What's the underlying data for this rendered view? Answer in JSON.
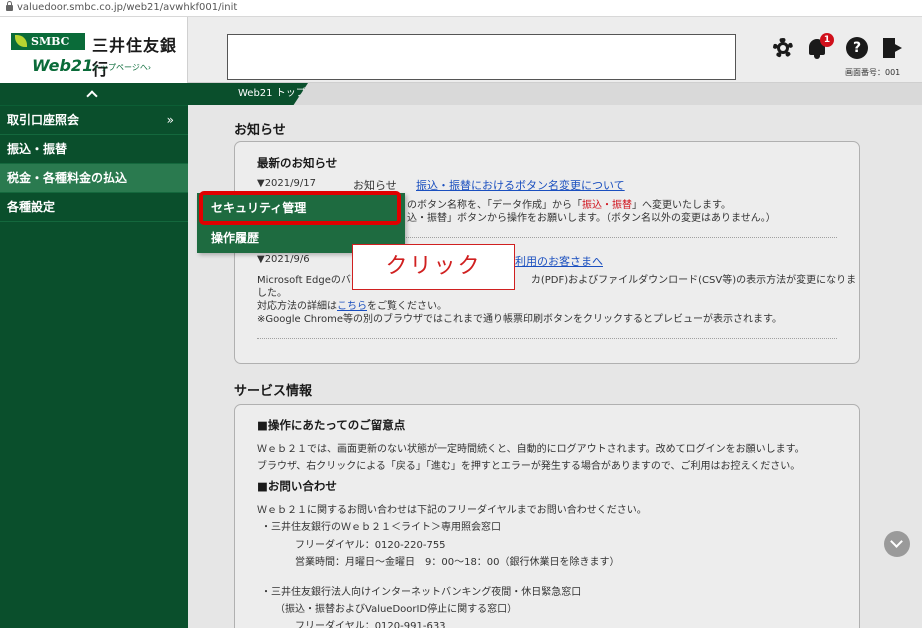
{
  "browser": {
    "url": "valuedoor.smbc.co.jp/web21/avwhkf001/init"
  },
  "header": {
    "brand_badge": "SMBC",
    "bank_name": "三井住友銀行",
    "web21": "Web21",
    "top_link": "トップページへ›",
    "notification_count": "1",
    "help_glyph": "?",
    "screen_number": "画面番号：001"
  },
  "sidebar": {
    "items": [
      {
        "label": "取引口座照会",
        "more": "»"
      },
      {
        "label": "振込・振替"
      },
      {
        "label": "税金・各種料金の払込"
      },
      {
        "label": "各種設定"
      }
    ]
  },
  "flyout": {
    "items": [
      {
        "label": "セキュリティ管理"
      },
      {
        "label": "操作履歴"
      }
    ]
  },
  "breadcrumb": {
    "label": "Web21 トップ"
  },
  "notice": {
    "title": "お知らせ",
    "latest_title": "最新のお知らせ",
    "item1": {
      "date": "▼2021/9/17",
      "category": "お知らせ",
      "link": "振込・振替におけるボタン名変更について",
      "line1_a": "のボタン名称を、「データ作成」から「",
      "line1_red": "振込・振替",
      "line1_b": "」へ変更いたします。",
      "line2": "込・振替」ボタンから操作をお願いします。（ボタン名以外の変更はありません。）"
    },
    "item2": {
      "date": "▼2021/9/6",
      "link_partial": "利用のお客さまへ",
      "line1_a": "Microsoft Edgeのバー",
      "line1_b": "カ(PDF)およびファイルダウンロード(CSV等)の表示方法が変更になりま",
      "line2": "した。",
      "line3_a": "対応方法の詳細は",
      "line3_link": "こちら",
      "line3_b": "をご覧ください。",
      "line4": "※Google Chrome等の別のブラウザではこれまで通り帳票印刷ボタンをクリックするとプレビューが表示されます。"
    }
  },
  "service": {
    "title": "サービス情報",
    "caution_title": "■操作にあたってのご留意点",
    "caution_line1": "Ｗｅｂ２１では、画面更新のない状態が一定時間続くと、自動的にログアウトされます。改めてログインをお願いします。",
    "caution_line2": "ブラウザ、右クリックによる「戻る」「進む」を押すとエラーが発生する場合がありますので、ご利用はお控えください。",
    "contact_title": "■お問い合わせ",
    "contact_intro": "Ｗｅｂ２１に関するお問い合わせは下記のフリーダイヤルまでお問い合わせください。",
    "contact1_name": "・三井住友銀行のＷｅｂ２１＜ライト＞専用照会窓口",
    "contact1_phone": "フリーダイヤル：0120-220-755",
    "contact1_hours": "営業時間：月曜日～金曜日　9：00～18：00（銀行休業日を除きます）",
    "contact2_name": "・三井住友銀行法人向けインターネットバンキング夜間・休日緊急窓口",
    "contact2_note": "（振込・振替およびValueDoorID停止に関する窓口）",
    "contact2_phone": "フリーダイヤル：0120-991-633"
  },
  "annotation": {
    "label": "クリック"
  },
  "colors": {
    "brand_green": "#0a4f2c",
    "highlight_red": "#e00000"
  }
}
